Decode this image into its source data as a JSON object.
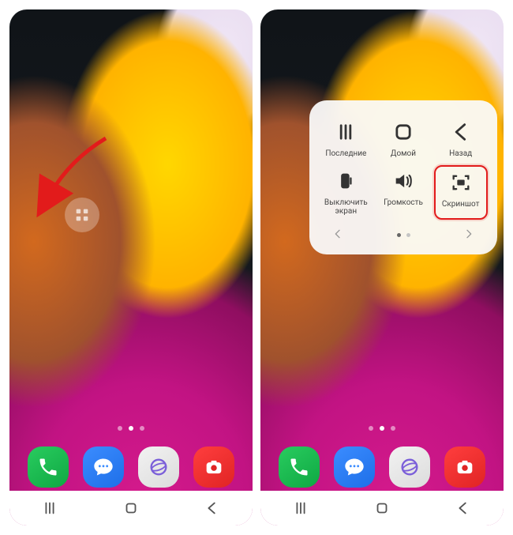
{
  "panel": {
    "items": [
      {
        "name": "recents-button",
        "label": "Последние",
        "interact": true
      },
      {
        "name": "home-button",
        "label": "Домой",
        "interact": true
      },
      {
        "name": "back-button",
        "label": "Назад",
        "interact": true
      },
      {
        "name": "lock-screen-button",
        "label": "Выключить экран",
        "interact": true
      },
      {
        "name": "volume-button",
        "label": "Громкость",
        "interact": true
      },
      {
        "name": "screenshot-button",
        "label": "Скриншот",
        "interact": true
      }
    ]
  },
  "dock": {
    "apps": [
      {
        "name": "phone-app",
        "icon": "phone-icon"
      },
      {
        "name": "messages-app",
        "icon": "message-icon"
      },
      {
        "name": "internet-app",
        "icon": "globe-icon"
      },
      {
        "name": "camera-app",
        "icon": "camera-icon"
      }
    ]
  },
  "nav": {
    "items": [
      {
        "name": "nav-recents",
        "icon": "recents-icon"
      },
      {
        "name": "nav-home",
        "icon": "home-icon"
      },
      {
        "name": "nav-back",
        "icon": "back-icon"
      }
    ]
  },
  "pageIndicator": {
    "total": 3,
    "active": 1
  },
  "panelPager": {
    "total": 2,
    "active": 0
  }
}
